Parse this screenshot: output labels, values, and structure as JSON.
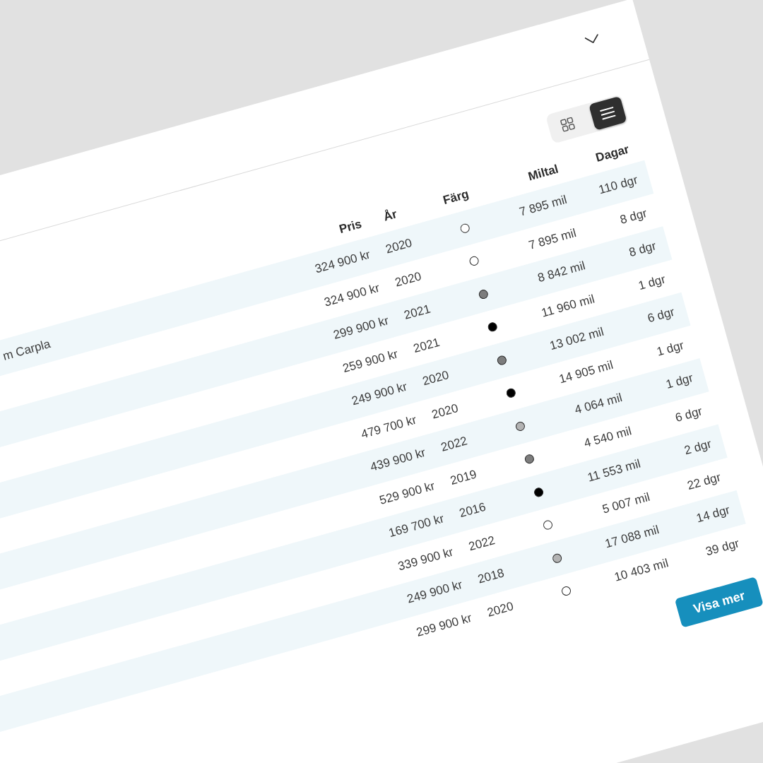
{
  "view_toggle": [
    {
      "kind": "grid",
      "selected": false
    },
    {
      "kind": "list",
      "selected": true
    }
  ],
  "table": {
    "columns": [
      "Pris",
      "År",
      "Färg",
      "Miltal",
      "Dagar"
    ],
    "rows": [
      {
        "column_1": "m Carpla",
        "price": "324 900 kr",
        "year": "2020",
        "color": "#ffffff",
        "mileage": "7 895 mil",
        "days": "110 dgr"
      },
      {
        "price": "324 900 kr",
        "year": "2020",
        "color": "#ffffff",
        "mileage": "7 895 mil",
        "days": "8 dgr"
      },
      {
        "price": "299 900 kr",
        "year": "2021",
        "color": "#7d7d7d",
        "mileage": "8 842 mil",
        "days": "8 dgr"
      },
      {
        "price": "259 900 kr",
        "year": "2021",
        "color": "#000000",
        "mileage": "11 960 mil",
        "days": "1 dgr"
      },
      {
        "price": "249 900 kr",
        "year": "2020",
        "color": "#7d7d7d",
        "mileage": "13 002 mil",
        "days": "6 dgr"
      },
      {
        "price": "479 700 kr",
        "year": "2020",
        "color": "#000000",
        "mileage": "14 905 mil",
        "days": "1 dgr"
      },
      {
        "price": "439 900 kr",
        "year": "2022",
        "color": "#b3b3b3",
        "mileage": "4 064 mil",
        "days": "1 dgr"
      },
      {
        "price": "529 900 kr",
        "year": "2019",
        "color": "#7d7d7d",
        "mileage": "4 540 mil",
        "days": "6 dgr"
      },
      {
        "price": "169 700 kr",
        "year": "2016",
        "color": "#000000",
        "mileage": "11 553 mil",
        "days": "2 dgr"
      },
      {
        "price": "339 900 kr",
        "year": "2022",
        "color": "#ffffff",
        "mileage": "5 007 mil",
        "days": "22 dgr"
      },
      {
        "price": "249 900 kr",
        "year": "2018",
        "color": "#b3b3b3",
        "mileage": "17 088 mil",
        "days": "14 dgr"
      },
      {
        "price": "299 900 kr",
        "year": "2020",
        "color": "#ffffff",
        "mileage": "10 403 mil",
        "days": "39 dgr"
      }
    ]
  },
  "show_more": {
    "label": "Visa mer"
  }
}
